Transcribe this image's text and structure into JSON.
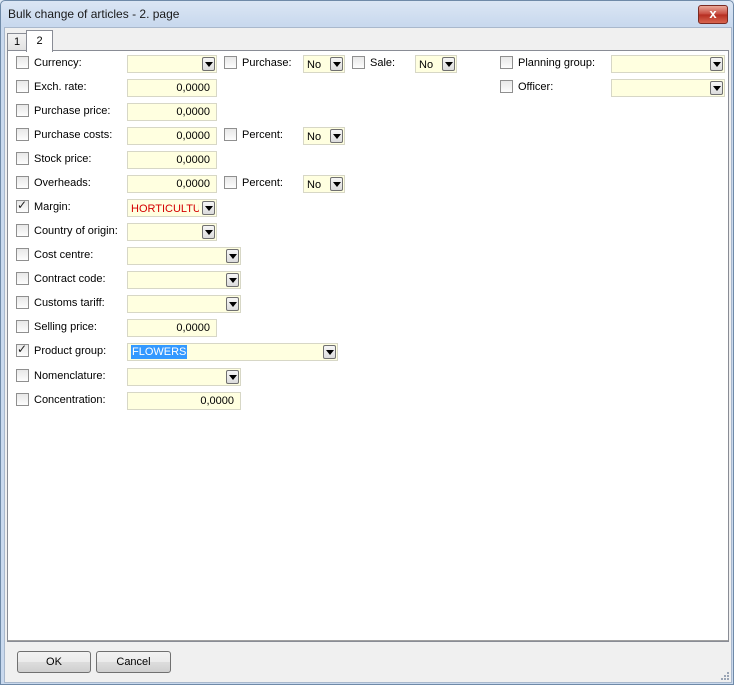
{
  "window": {
    "title": "Bulk change of articles - 2. page",
    "close_glyph": "x"
  },
  "tabs": [
    {
      "label": "1",
      "active": false
    },
    {
      "label": "2",
      "active": true
    }
  ],
  "fields": {
    "currency": {
      "label": "Currency:",
      "checked": false,
      "value": ""
    },
    "purchase": {
      "label": "Purchase:",
      "checked": false,
      "value": "No"
    },
    "sale": {
      "label": "Sale:",
      "checked": false,
      "value": "No"
    },
    "planning_group": {
      "label": "Planning group:",
      "checked": false,
      "value": ""
    },
    "exch_rate": {
      "label": "Exch. rate:",
      "checked": false,
      "value": "0,0000"
    },
    "officer": {
      "label": "Officer:",
      "checked": false,
      "value": ""
    },
    "purchase_price": {
      "label": "Purchase price:",
      "checked": false,
      "value": "0,0000"
    },
    "purchase_costs": {
      "label": "Purchase costs:",
      "checked": false,
      "value": "0,0000"
    },
    "purchase_costs_percent": {
      "label": "Percent:",
      "checked": false,
      "value": "No"
    },
    "stock_price": {
      "label": "Stock price:",
      "checked": false,
      "value": "0,0000"
    },
    "overheads": {
      "label": "Overheads:",
      "checked": false,
      "value": "0,0000"
    },
    "overheads_percent": {
      "label": "Percent:",
      "checked": false,
      "value": "No"
    },
    "margin": {
      "label": "Margin:",
      "checked": true,
      "value": "HORTICULTU"
    },
    "country_of_origin": {
      "label": "Country of origin:",
      "checked": false,
      "value": ""
    },
    "cost_centre": {
      "label": "Cost centre:",
      "checked": false,
      "value": ""
    },
    "contract_code": {
      "label": "Contract code:",
      "checked": false,
      "value": ""
    },
    "customs_tariff": {
      "label": "Customs tariff:",
      "checked": false,
      "value": ""
    },
    "selling_price": {
      "label": "Selling price:",
      "checked": false,
      "value": "0,0000"
    },
    "product_group": {
      "label": "Product group:",
      "checked": true,
      "value": "FLOWERS"
    },
    "nomenclature": {
      "label": "Nomenclature:",
      "checked": false,
      "value": ""
    },
    "concentration": {
      "label": "Concentration:",
      "checked": false,
      "value": "0,0000"
    }
  },
  "buttons": {
    "ok": "OK",
    "cancel": "Cancel"
  },
  "colors": {
    "field_bg": "#ffffe0",
    "selection": "#3399ff",
    "margin_text": "#d40000"
  }
}
